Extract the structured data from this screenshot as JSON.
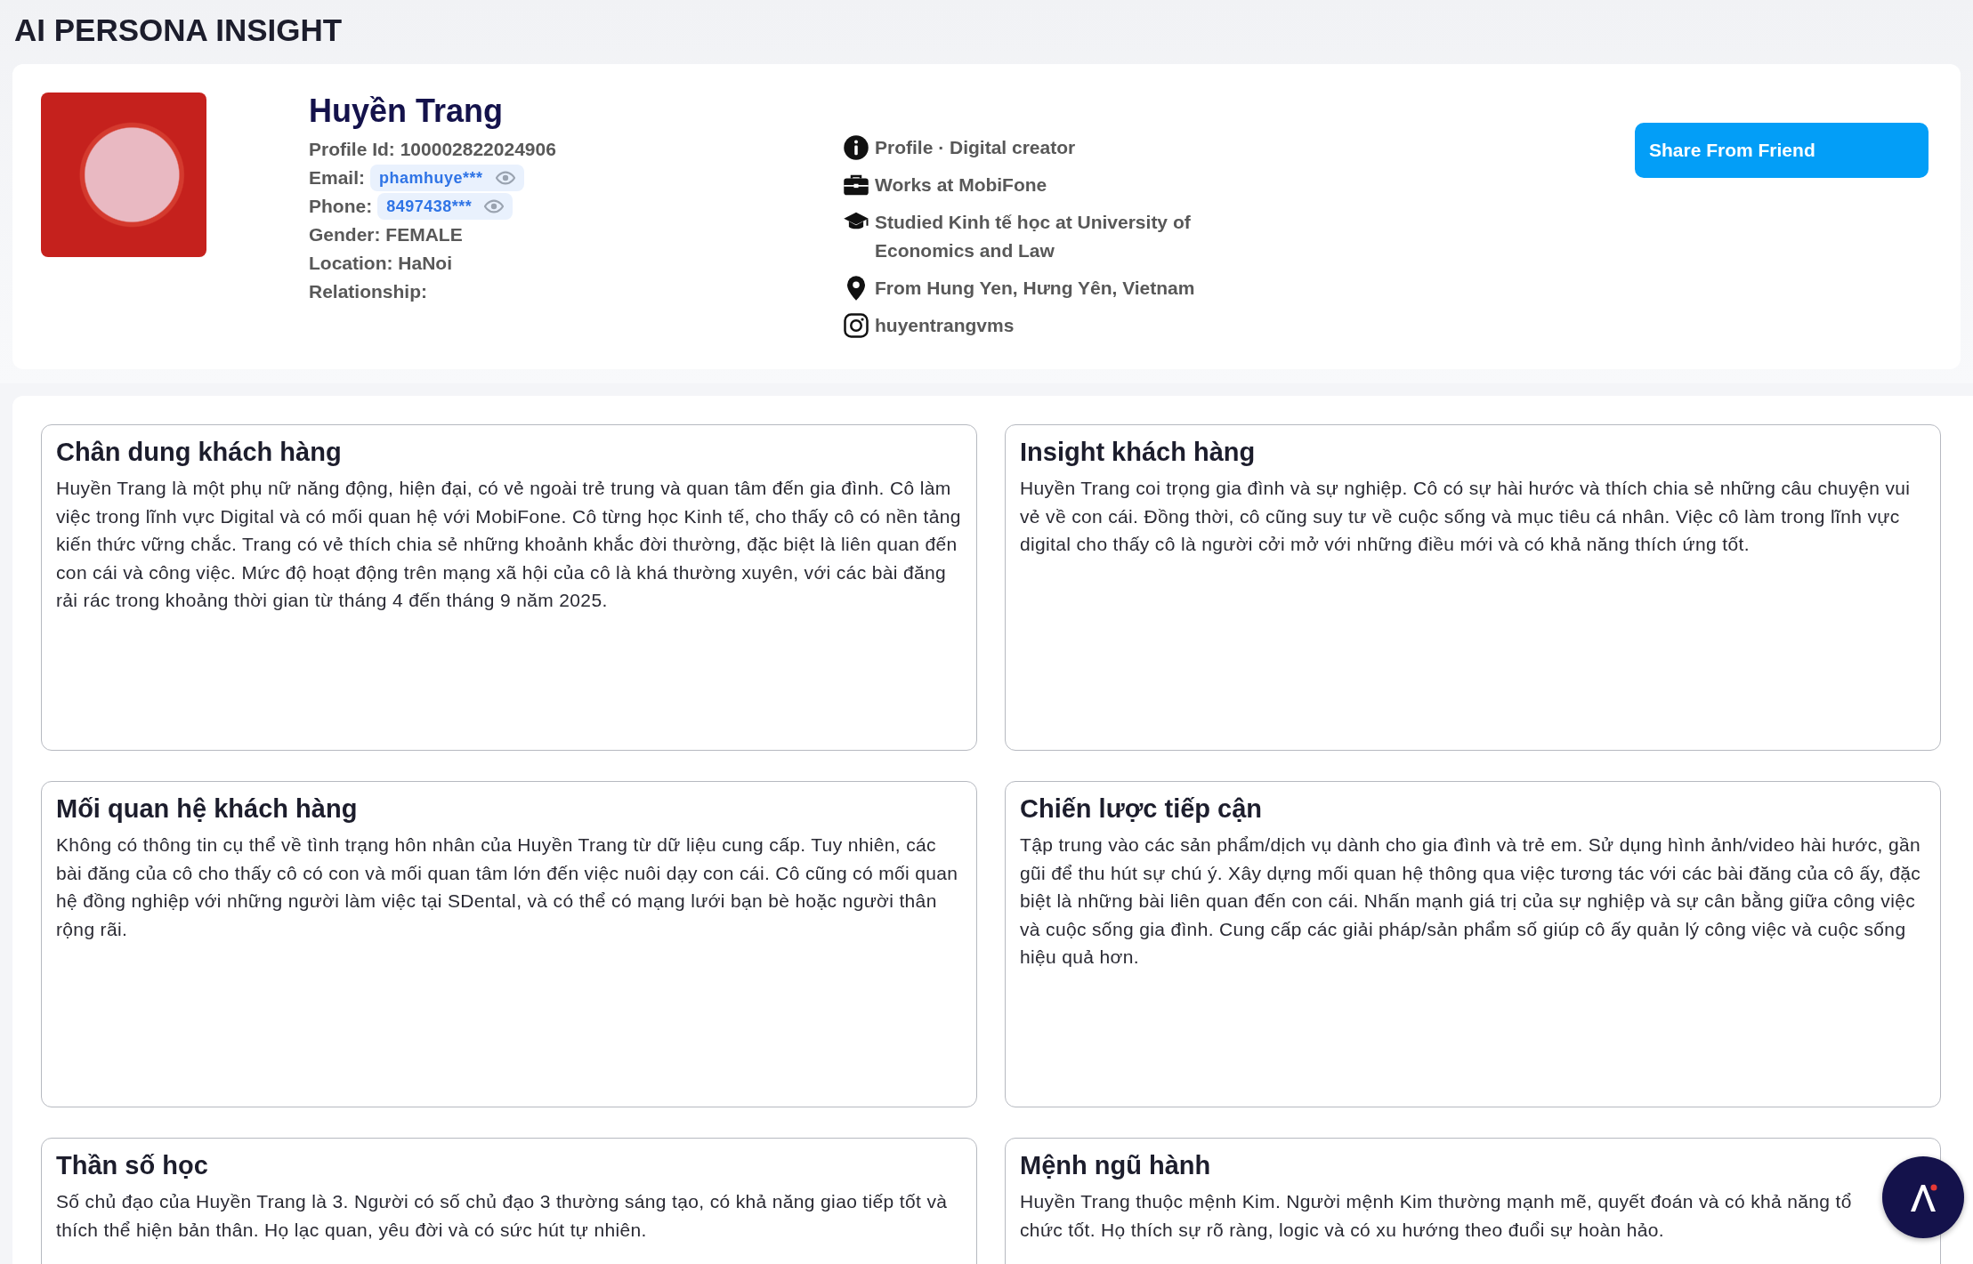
{
  "title": "AI PERSONA INSIGHT",
  "profile": {
    "name": "Huyền Trang",
    "fields": [
      {
        "kind": "plain",
        "text": "Profile Id: 100002822024906"
      },
      {
        "kind": "masked",
        "label": "Email:",
        "value": "phamhuye***"
      },
      {
        "kind": "masked",
        "label": "Phone:",
        "value": "8497438***"
      },
      {
        "kind": "plain",
        "text": "Gender: FEMALE"
      },
      {
        "kind": "plain",
        "text": "Location: HaNoi"
      },
      {
        "kind": "plain",
        "text": "Relationship:"
      }
    ],
    "about": [
      {
        "kind": "info",
        "text": "Profile · Digital creator"
      },
      {
        "kind": "briefcase",
        "text": "Works at MobiFone"
      },
      {
        "kind": "graduation",
        "text": "Studied Kinh tế học at University of Economics and Law"
      },
      {
        "kind": "pin",
        "text": "From Hung Yen, Hưng Yên, Vietnam"
      },
      {
        "kind": "instagram",
        "text": "huyentrangvms"
      }
    ],
    "share_button": "Share From Friend"
  },
  "sections": [
    {
      "title": "Chân dung khách hàng",
      "text": "Huyền Trang là một phụ nữ năng động, hiện đại, có vẻ ngoài trẻ trung và quan tâm đến gia đình. Cô làm việc trong lĩnh vực Digital và có mối quan hệ với MobiFone. Cô từng học Kinh tế, cho thấy cô có nền tảng kiến thức vững chắc. Trang có vẻ thích chia sẻ những khoảnh khắc đời thường, đặc biệt là liên quan đến con cái và công việc. Mức độ hoạt động trên mạng xã hội của cô là khá thường xuyên, với các bài đăng rải rác trong khoảng thời gian từ tháng 4 đến tháng 9 năm 2025."
    },
    {
      "title": "Insight khách hàng",
      "text": "Huyền Trang coi trọng gia đình và sự nghiệp. Cô có sự hài hước và thích chia sẻ những câu chuyện vui vẻ về con cái. Đồng thời, cô cũng suy tư về cuộc sống và mục tiêu cá nhân. Việc cô làm trong lĩnh vực digital cho thấy cô là người cởi mở với những điều mới và có khả năng thích ứng tốt."
    },
    {
      "title": "Mối quan hệ khách hàng",
      "text": "Không có thông tin cụ thể về tình trạng hôn nhân của Huyền Trang từ dữ liệu cung cấp. Tuy nhiên, các bài đăng của cô cho thấy cô có con và mối quan tâm lớn đến việc nuôi dạy con cái. Cô cũng có mối quan hệ đồng nghiệp với những người làm việc tại SDental, và có thể có mạng lưới bạn bè hoặc người thân rộng rãi."
    },
    {
      "title": "Chiến lược tiếp cận",
      "text": "Tập trung vào các sản phẩm/dịch vụ dành cho gia đình và trẻ em. Sử dụng hình ảnh/video hài hước, gần gũi để thu hút sự chú ý. Xây dựng mối quan hệ thông qua việc tương tác với các bài đăng của cô ấy, đặc biệt là những bài liên quan đến con cái. Nhấn mạnh giá trị của sự nghiệp và sự cân bằng giữa công việc và cuộc sống gia đình. Cung cấp các giải pháp/sản phẩm số giúp cô ấy quản lý công việc và cuộc sống hiệu quả hơn."
    },
    {
      "title": "Thần số học",
      "text": "Số chủ đạo của Huyền Trang là 3. Người có số chủ đạo 3 thường sáng tạo, có khả năng giao tiếp tốt và thích thể hiện bản thân. Họ lạc quan, yêu đời và có sức hút tự nhiên."
    },
    {
      "title": "Mệnh ngũ hành",
      "text": "Huyền Trang thuộc mệnh Kim. Người mệnh Kim thường mạnh mẽ, quyết đoán và có khả năng tổ chức tốt. Họ thích sự rõ ràng, logic và có xu hướng theo đuổi sự hoàn hảo."
    }
  ]
}
